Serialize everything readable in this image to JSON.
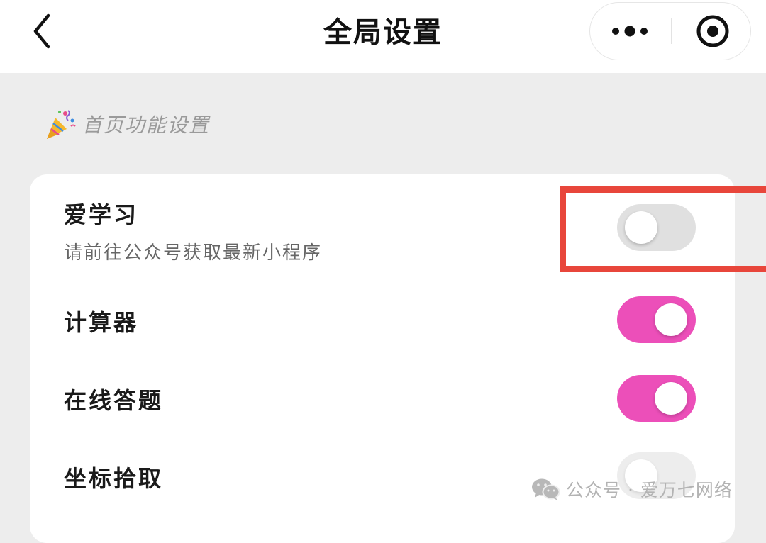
{
  "nav": {
    "title": "全局设置",
    "back_icon": "chevron-left-icon",
    "more_icon": "more-dots-icon",
    "close_icon": "record-circle-icon"
  },
  "section": {
    "icon": "party-popper-icon",
    "title": "首页功能设置"
  },
  "settings": [
    {
      "title": "爱学习",
      "subtitle": "请前往公众号获取最新小程序",
      "enabled": false,
      "highlighted": true
    },
    {
      "title": "计算器",
      "enabled": true
    },
    {
      "title": "在线答题",
      "enabled": true
    },
    {
      "title": "坐标拾取",
      "enabled": false
    }
  ],
  "watermark": {
    "icon": "wechat-icon",
    "text": "公众号 · 爱万七网络"
  },
  "colors": {
    "toggle_on": "#ec4fb9",
    "toggle_off": "#e0e0e0",
    "highlight": "#e8463b",
    "background": "#ededed"
  }
}
